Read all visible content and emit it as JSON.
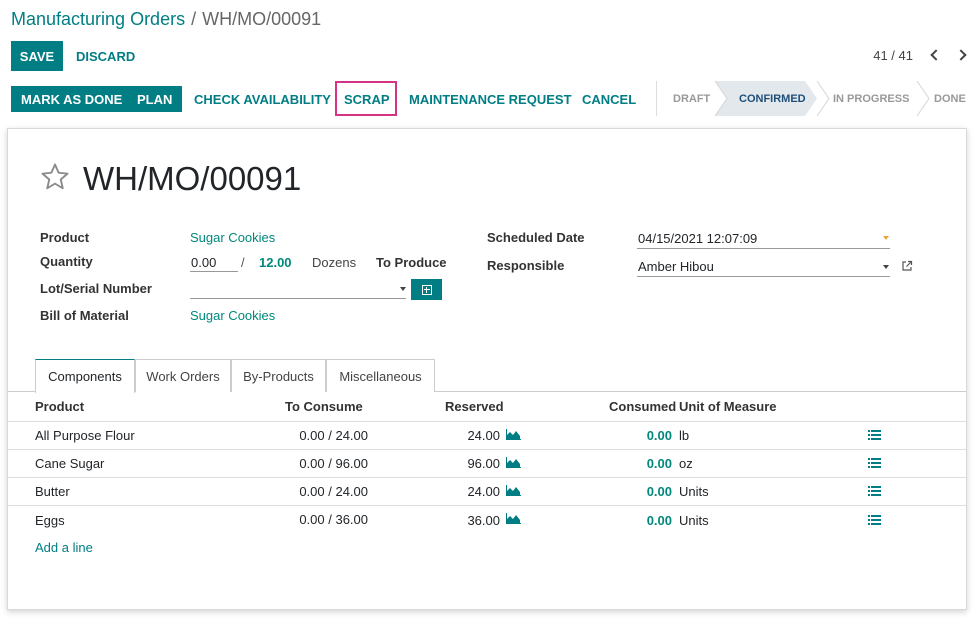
{
  "breadcrumb": {
    "parent": "Manufacturing Orders",
    "separator": "/",
    "current": "WH/MO/00091"
  },
  "toolbar": {
    "save_label": "SAVE",
    "discard_label": "DISCARD",
    "pager": "41 / 41"
  },
  "actions": {
    "mark_as_done": "MARK AS DONE",
    "plan": "PLAN",
    "check_availability": "CHECK AVAILABILITY",
    "scrap": "SCRAP",
    "maintenance_request": "MAINTENANCE REQUEST",
    "cancel": "CANCEL"
  },
  "statusbar": {
    "stages": [
      {
        "label": "DRAFT",
        "active": false
      },
      {
        "label": "CONFIRMED",
        "active": true
      },
      {
        "label": "IN PROGRESS",
        "active": false
      },
      {
        "label": "DONE",
        "active": false
      }
    ]
  },
  "record": {
    "name": "WH/MO/00091",
    "product_label": "Product",
    "product": "Sugar Cookies",
    "quantity_label": "Quantity",
    "quantity_produced": "0.00",
    "quantity_sep": "/",
    "quantity_total": "12.00",
    "uom": "Dozens",
    "to_produce_label": "To Produce",
    "lot_label": "Lot/Serial Number",
    "lot": "",
    "bom_label": "Bill of Material",
    "bom": "Sugar Cookies",
    "scheduled_date_label": "Scheduled Date",
    "scheduled_date": "04/15/2021 12:07:09",
    "responsible_label": "Responsible",
    "responsible": "Amber Hibou"
  },
  "tabs": [
    {
      "label": "Components",
      "active": true
    },
    {
      "label": "Work Orders",
      "active": false
    },
    {
      "label": "By-Products",
      "active": false
    },
    {
      "label": "Miscellaneous",
      "active": false
    }
  ],
  "table": {
    "headers": {
      "product": "Product",
      "to_consume": "To Consume",
      "reserved": "Reserved",
      "consumed": "Consumed",
      "uom": "Unit of Measure"
    },
    "rows": [
      {
        "product": "All Purpose Flour",
        "to_consume": "0.00 / 24.00",
        "reserved": "24.00",
        "consumed": "0.00",
        "uom": "lb"
      },
      {
        "product": "Cane Sugar",
        "to_consume": "0.00 / 96.00",
        "reserved": "96.00",
        "consumed": "0.00",
        "uom": "oz"
      },
      {
        "product": "Butter",
        "to_consume": "0.00 / 24.00",
        "reserved": "24.00",
        "consumed": "0.00",
        "uom": "Units"
      },
      {
        "product": "Eggs",
        "to_consume": "0.00 / 36.00",
        "reserved": "36.00",
        "consumed": "0.00",
        "uom": "Units"
      }
    ],
    "add_line": "Add a line"
  },
  "colors": {
    "brand": "#017e84",
    "highlight": "#d63384",
    "active_stage_bg": "#e2e8ec"
  }
}
